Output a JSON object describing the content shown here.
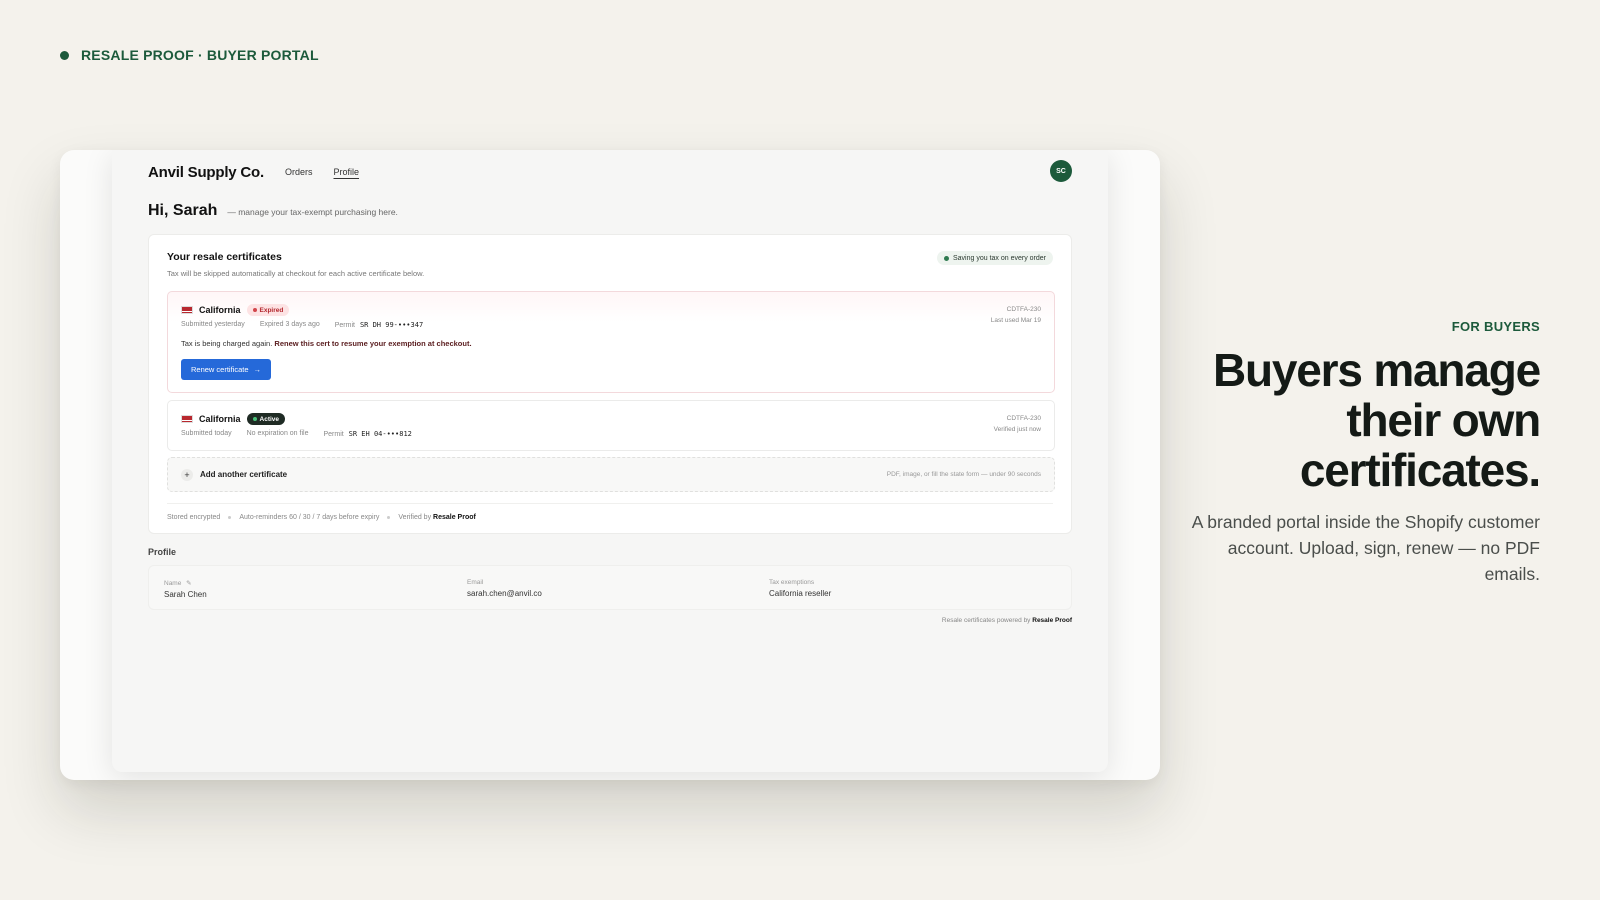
{
  "brand": {
    "label": "RESALE PROOF · BUYER PORTAL",
    "accent": "#1c5a3b"
  },
  "portal": {
    "store_name": "Anvil Supply Co.",
    "nav": [
      "Orders",
      "Profile"
    ],
    "avatar_initials": "SC",
    "greeting": "Hi, Sarah",
    "greeting_sub": "— manage your tax-exempt purchasing here.",
    "certs_card": {
      "title": "Your resale certificates",
      "subtitle": "Tax will be skipped automatically at checkout for each active certificate below.",
      "saving_badge": "Saving you tax on every order",
      "certificates": [
        {
          "state": "California",
          "status": "Expired",
          "submitted": "Submitted yesterday",
          "expiry": "Expired 3 days ago",
          "permit_label": "Permit",
          "permit_number": "SR DH 99-•••347",
          "form_code": "CDTFA-230",
          "usage": "Last used Mar 19",
          "warning": "Tax is being charged again.",
          "warning_bold": "Renew this cert to resume your exemption at checkout.",
          "action_label": "Renew certificate",
          "action_icon": "arrow-right-icon"
        },
        {
          "state": "California",
          "status": "Active",
          "submitted": "Submitted today",
          "expiry": "No expiration on file",
          "permit_label": "Permit",
          "permit_number": "SR EH 04-•••812",
          "form_code": "CDTFA-230",
          "usage": "Verified just now"
        }
      ],
      "add": {
        "label": "Add another certificate",
        "hint": "PDF, image, or fill the state form — under 90 seconds",
        "icon": "plus-icon"
      },
      "footer": {
        "stored": "Stored encrypted",
        "reminders": "Auto-reminders 60 / 30 / 7 days before expiry",
        "verified_prefix": "Verified by",
        "verified_brand": "Resale Proof"
      }
    },
    "profile": {
      "heading": "Profile",
      "fields": [
        {
          "key": "Name",
          "value": "Sarah Chen",
          "icon": "pencil-icon"
        },
        {
          "key": "Email",
          "value": "sarah.chen@anvil.co"
        },
        {
          "key": "Tax exemptions",
          "value": "California reseller"
        }
      ],
      "powered_prefix": "Resale certificates powered by",
      "powered_brand": "Resale Proof"
    }
  },
  "marketing": {
    "eyebrow": "FOR BUYERS",
    "headline": "Buyers manage their own certificates.",
    "description": "A branded portal inside the Shopify customer account. Upload, sign, renew — no PDF emails."
  }
}
